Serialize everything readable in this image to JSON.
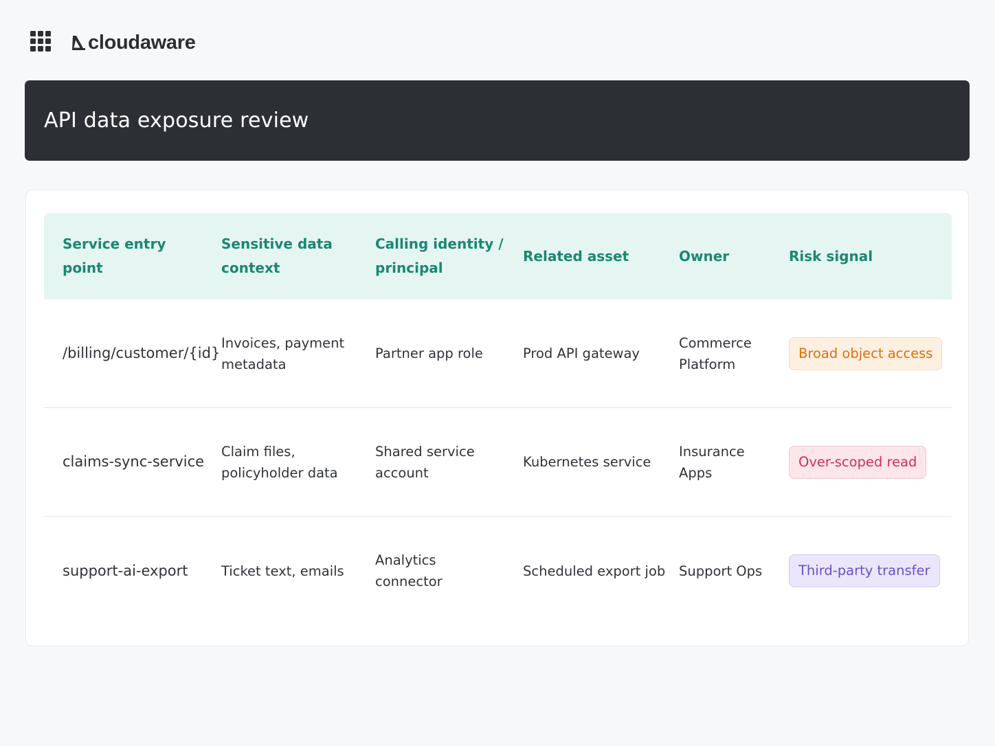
{
  "brand": {
    "name": "cloudaware"
  },
  "page": {
    "title": "API data exposure review"
  },
  "table": {
    "headers": [
      {
        "line1": "Service entry",
        "line2": "point"
      },
      {
        "line1": "Sensitive data",
        "line2": "context"
      },
      {
        "line1": "Calling identity /",
        "line2": "principal"
      },
      {
        "line1": "Related asset",
        "line2": ""
      },
      {
        "line1": "Owner",
        "line2": ""
      },
      {
        "line1": "Risk signal",
        "line2": ""
      }
    ],
    "rows": [
      {
        "entry": "/billing/customer/{id}",
        "data_line1": "Invoices, payment",
        "data_line2": "metadata",
        "identity_line1": "Partner app role",
        "identity_line2": "",
        "asset": "Prod API gateway",
        "owner_line1": "Commerce",
        "owner_line2": "Platform",
        "risk": "Broad object access",
        "risk_color": "#d9700f"
      },
      {
        "entry": "claims-sync-service",
        "data_line1": "Claim files,",
        "data_line2": "policyholder data",
        "identity_line1": "Shared service",
        "identity_line2": "account",
        "asset": "Kubernetes service",
        "owner_line1": "Insurance",
        "owner_line2": "Apps",
        "risk": "Over-scoped read",
        "risk_color": "#d32e56"
      },
      {
        "entry": "support-ai-export",
        "data_line1": "Ticket text, emails",
        "data_line2": "",
        "identity_line1": "Analytics",
        "identity_line2": "connector",
        "asset": "Scheduled export job",
        "owner_line1": "Support Ops",
        "owner_line2": "",
        "risk": "Third-party transfer",
        "risk_color": "#6b4fc8"
      }
    ]
  },
  "colors": {
    "banner_bg": "#2c3035",
    "header_bg": "#e5f5f2",
    "header_text": "#1b8772"
  }
}
